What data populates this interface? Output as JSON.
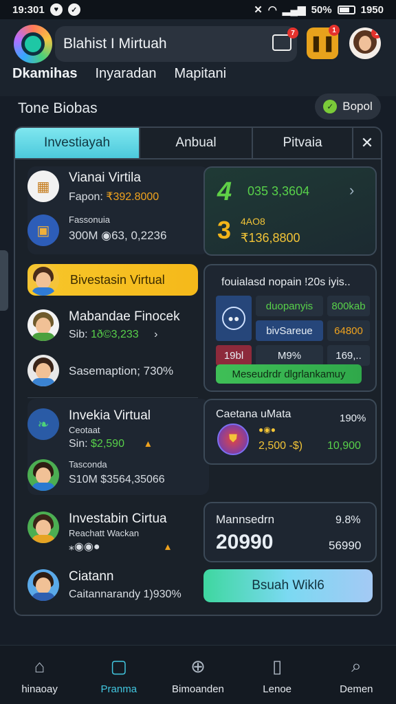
{
  "status_bar": {
    "time": "19:301",
    "battery": "50%",
    "clock_right": "1950"
  },
  "header": {
    "title": "Blahist I Mirtuah",
    "msg_badge": "7",
    "pause_badge": "1",
    "avatar_badge": "1",
    "nav": [
      "Dkamihas",
      "Inyaradan",
      "Mapitani"
    ]
  },
  "section": {
    "title": "Tone Biobas",
    "report_label": "Bopol"
  },
  "tabs": [
    "Investiayah",
    "Anbual",
    "Pitvaia"
  ],
  "left_items": [
    {
      "title": "Vianai Virtila",
      "sub_prefix": "Fapon:",
      "sub_value": "₹392.8000"
    },
    {
      "title": "Fassonuia",
      "sub_prefix": "300M",
      "sub_value": "◉63, 0,2236"
    },
    {
      "title": "Bivestasin Virtual"
    },
    {
      "title": "Mabandae Finocek",
      "sub_prefix": "Sib:",
      "sub_value": "1ð©3,233"
    },
    {
      "title": "Sasemaption; 730%"
    },
    {
      "title": "Invekia Virtual",
      "line2": "Ceotaat",
      "sub_prefix": "Sin:",
      "sub_value": "$2,590"
    },
    {
      "title": "Tasconda",
      "sub_prefix": "S10M",
      "sub_value": "$3564,35066"
    },
    {
      "title": "Investabin Cirtua",
      "line2": "Reachatt Wackan"
    },
    {
      "title": "Ciatann",
      "sub": "Caitannarandy 1)930%"
    }
  ],
  "right_cards": {
    "card1": {
      "amount": "035 3,3604",
      "value": "₹136,8800",
      "label": "4AO8"
    },
    "card2": {
      "title": "fouialasd nopain !20s iyis..",
      "grid": [
        [
          "",
          "duopanyis",
          "800kab"
        ],
        [
          "",
          "bivSareue",
          "64800"
        ],
        [
          "19bl",
          "M9%",
          "169,.."
        ]
      ],
      "bar": "Meseudrdr dlgrlankamuy"
    },
    "card3": {
      "title": "Caetana uMata",
      "pct": "190%",
      "range": "2,500 -$)",
      "value": "10,900"
    },
    "card4": {
      "title": "Mannsedrn",
      "pct": "9.8%",
      "big": "20990",
      "value": "56990"
    },
    "cta": "Bsuah Wikl6"
  },
  "bottom_nav": [
    {
      "label": "hinaoay",
      "icon": "home-icon"
    },
    {
      "label": "Pranma",
      "icon": "bag-icon"
    },
    {
      "label": "Bimoanden",
      "icon": "download-circle-icon"
    },
    {
      "label": "Lenoe",
      "icon": "clipboard-icon"
    },
    {
      "label": "Demen",
      "icon": "search-icon"
    }
  ],
  "colors": {
    "accent": "#42c7e0",
    "highlight": "#f5c02a",
    "positive": "#58d14a"
  }
}
